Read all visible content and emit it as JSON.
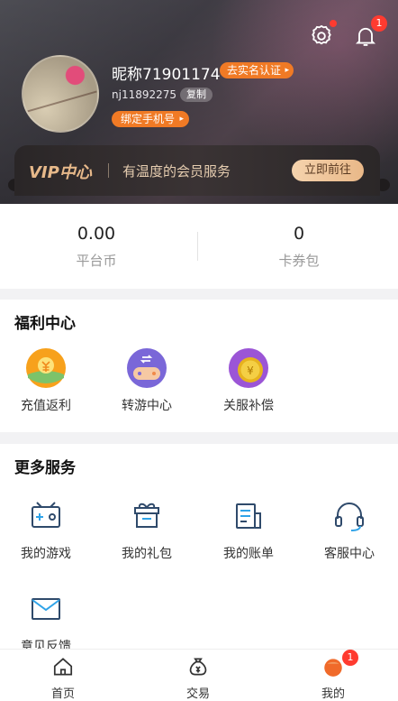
{
  "header": {
    "settings_dot": true,
    "bell_badge": "1",
    "nickname": "昵称71901174",
    "realname_button": "去实名认证",
    "account_id": "nj11892275",
    "copy_button": "复制",
    "bind_phone_button": "绑定手机号"
  },
  "vip": {
    "logo": "VIP中心",
    "tagline": "有温度的会员服务",
    "cta": "立即前往"
  },
  "wallet": {
    "items": [
      {
        "value": "0.00",
        "label": "平台币"
      },
      {
        "value": "0",
        "label": "卡券包"
      }
    ]
  },
  "welfare": {
    "title": "福利中心",
    "items": [
      {
        "label": "充值返利",
        "icon": "recharge-rebate-icon"
      },
      {
        "label": "转游中心",
        "icon": "game-transfer-icon"
      },
      {
        "label": "关服补偿",
        "icon": "server-close-compensation-icon"
      }
    ]
  },
  "more_services": {
    "title": "更多服务",
    "items": [
      {
        "label": "我的游戏",
        "icon": "game-console-icon"
      },
      {
        "label": "我的礼包",
        "icon": "gift-icon"
      },
      {
        "label": "我的账单",
        "icon": "bill-icon"
      },
      {
        "label": "客服中心",
        "icon": "headset-icon"
      },
      {
        "label": "意见反馈",
        "icon": "mail-icon"
      }
    ]
  },
  "tabbar": {
    "tabs": [
      {
        "label": "首页",
        "icon": "home-icon"
      },
      {
        "label": "交易",
        "icon": "money-bag-icon"
      },
      {
        "label": "我的",
        "icon": "profile-icon",
        "badge": "1"
      }
    ]
  },
  "colors": {
    "accent_orange": "#f07a25",
    "badge_red": "#ff3b30",
    "vip_gold": "#e7b98a",
    "icon_blue": "#2f4a6b"
  }
}
